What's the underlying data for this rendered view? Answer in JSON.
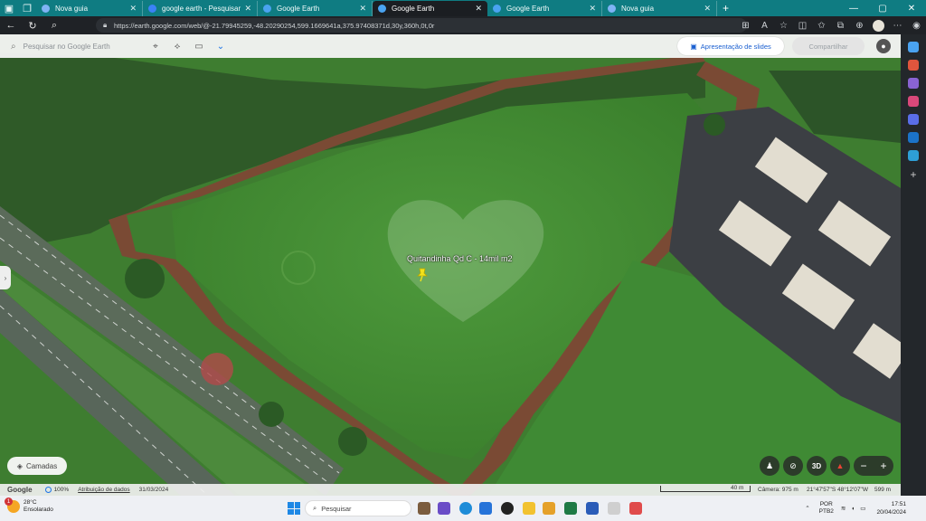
{
  "browser": {
    "tabs": [
      {
        "label": "Nova guia",
        "favicon_color": "#7fb3f5",
        "active": false
      },
      {
        "label": "google earth - Pesquisar",
        "favicon_color": "#3b82f6",
        "active": false
      },
      {
        "label": "Google Earth",
        "favicon_color": "#4aa3f0",
        "active": false
      },
      {
        "label": "Google Earth",
        "favicon_color": "#4aa3f0",
        "active": true
      },
      {
        "label": "Google Earth",
        "favicon_color": "#4aa3f0",
        "active": false
      },
      {
        "label": "Nova guia",
        "favicon_color": "#7fb3f5",
        "active": false
      }
    ],
    "url": "https://earth.google.com/web/@-21.79945259,-48.20290254,599.1669641a,375.97408371d,30y,360h,0t,0r"
  },
  "earth": {
    "search_placeholder": "Pesquisar no Google Earth",
    "slides_label": "Apresentação de slides",
    "share_label": "Compartilhar",
    "placemark_label": "Quitandinha Qd C - 14mil m2",
    "layers_label": "Camadas",
    "btn_3d": "3D",
    "zoom_minus": "−",
    "zoom_plus": "+"
  },
  "footer": {
    "logo": "Google",
    "percent": "100%",
    "attribution": "Atribuição de dados",
    "imagery_date": "31/03/2024",
    "scale": "40 m",
    "camera": "Câmera: 975 m",
    "coords": "21°47'57\"S 48°12'07\"W",
    "altitude": "599 m"
  },
  "taskbar": {
    "weather_temp": "28°C",
    "weather_desc": "Ensolarado",
    "weather_badge": "1",
    "search_label": "Pesquisar",
    "lang": "POR",
    "lang_sub": "PTB2",
    "time": "17:51",
    "date": "20/04/2024"
  }
}
